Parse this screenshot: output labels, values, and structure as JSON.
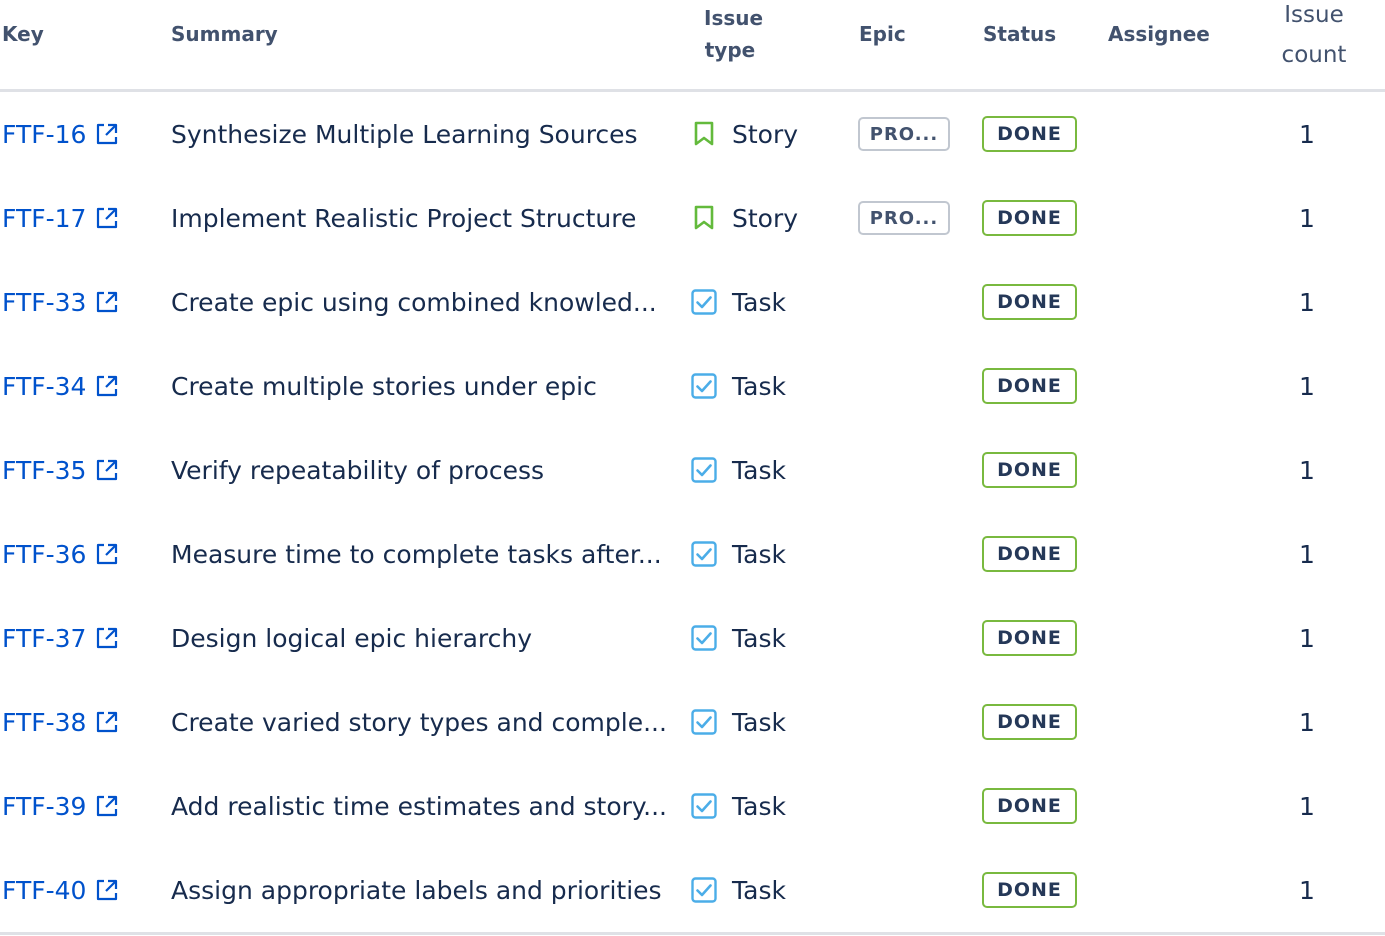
{
  "columns": {
    "key": "Key",
    "summary": "Summary",
    "issue_type_line1": "Issue",
    "issue_type_line2": "type",
    "epic": "Epic",
    "status": "Status",
    "assignee": "Assignee",
    "issue_count_line1": "Issue",
    "issue_count_line2": "count"
  },
  "colors": {
    "link": "#0052cc",
    "story_icon": "#63ba3c",
    "task_icon": "#4bade8",
    "done_border": "#79b93f"
  },
  "rows": [
    {
      "key": "FTF-16",
      "summary": "Synthesize Multiple Learning Sources",
      "type": "Story",
      "type_icon": "bookmark-icon",
      "epic": "PRO...",
      "status": "DONE",
      "assignee": "",
      "count": "1"
    },
    {
      "key": "FTF-17",
      "summary": "Implement Realistic Project Structure",
      "type": "Story",
      "type_icon": "bookmark-icon",
      "epic": "PRO...",
      "status": "DONE",
      "assignee": "",
      "count": "1"
    },
    {
      "key": "FTF-33",
      "summary": "Create epic using combined knowled...",
      "type": "Task",
      "type_icon": "checkbox-icon",
      "epic": "",
      "status": "DONE",
      "assignee": "",
      "count": "1"
    },
    {
      "key": "FTF-34",
      "summary": "Create multiple stories under epic",
      "type": "Task",
      "type_icon": "checkbox-icon",
      "epic": "",
      "status": "DONE",
      "assignee": "",
      "count": "1"
    },
    {
      "key": "FTF-35",
      "summary": "Verify repeatability of process",
      "type": "Task",
      "type_icon": "checkbox-icon",
      "epic": "",
      "status": "DONE",
      "assignee": "",
      "count": "1"
    },
    {
      "key": "FTF-36",
      "summary": "Measure time to complete tasks after...",
      "type": "Task",
      "type_icon": "checkbox-icon",
      "epic": "",
      "status": "DONE",
      "assignee": "",
      "count": "1"
    },
    {
      "key": "FTF-37",
      "summary": "Design logical epic hierarchy",
      "type": "Task",
      "type_icon": "checkbox-icon",
      "epic": "",
      "status": "DONE",
      "assignee": "",
      "count": "1"
    },
    {
      "key": "FTF-38",
      "summary": "Create varied story types and comple...",
      "type": "Task",
      "type_icon": "checkbox-icon",
      "epic": "",
      "status": "DONE",
      "assignee": "",
      "count": "1"
    },
    {
      "key": "FTF-39",
      "summary": "Add realistic time estimates and story...",
      "type": "Task",
      "type_icon": "checkbox-icon",
      "epic": "",
      "status": "DONE",
      "assignee": "",
      "count": "1"
    },
    {
      "key": "FTF-40",
      "summary": "Assign appropriate labels and priorities",
      "type": "Task",
      "type_icon": "checkbox-icon",
      "epic": "",
      "status": "DONE",
      "assignee": "",
      "count": "1"
    }
  ]
}
